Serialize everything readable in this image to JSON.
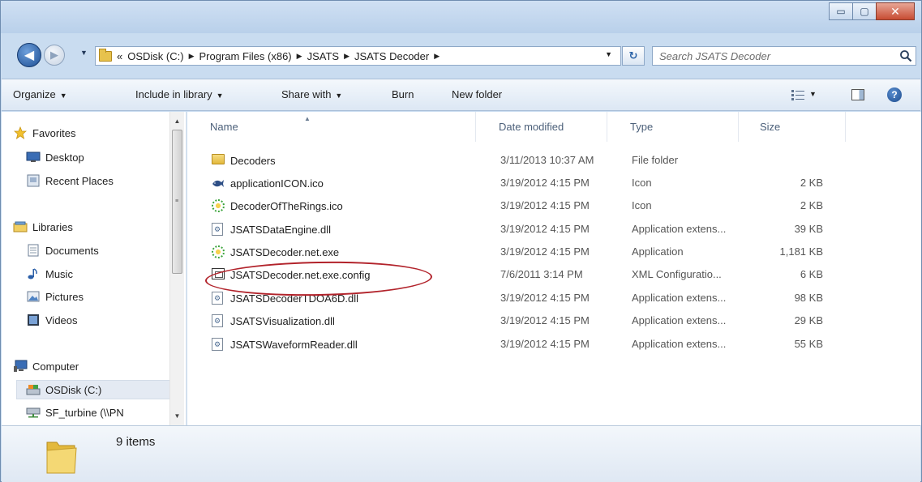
{
  "window": {
    "controls": {
      "minimize": "▭",
      "maximize": "▢",
      "close": "✕"
    }
  },
  "navigation": {
    "back_glyph": "◀",
    "forward_glyph": "▶",
    "history_dropdown": "▼",
    "breadcrumb_overflow": "«",
    "breadcrumbs": [
      "OSDisk (C:)",
      "Program Files (x86)",
      "JSATS",
      "JSATS Decoder"
    ],
    "address_dropdown": "▼",
    "refresh_glyph": "↻",
    "search_placeholder": "Search JSATS Decoder"
  },
  "toolbar": {
    "organize": "Organize",
    "include_in_library": "Include in library",
    "share_with": "Share with",
    "burn": "Burn",
    "new_folder": "New folder",
    "dropdown_glyph": "▼",
    "help_glyph": "?"
  },
  "sidebar": {
    "scroll_up": "▲",
    "scroll_down": "▼",
    "grip": "≡",
    "favorites": {
      "label": "Favorites",
      "icon": "star-icon"
    },
    "favorite_items": [
      {
        "label": "Desktop",
        "icon": "desktop-icon"
      },
      {
        "label": "Recent Places",
        "icon": "recent-places-icon"
      }
    ],
    "libraries": {
      "label": "Libraries",
      "icon": "libraries-icon"
    },
    "library_items": [
      {
        "label": "Documents",
        "icon": "documents-icon"
      },
      {
        "label": "Music",
        "icon": "music-icon"
      },
      {
        "label": "Pictures",
        "icon": "pictures-icon"
      },
      {
        "label": "Videos",
        "icon": "videos-icon"
      }
    ],
    "computer": {
      "label": "Computer",
      "icon": "computer-icon"
    },
    "computer_items": [
      {
        "label": "OSDisk (C:)",
        "icon": "drive-icon",
        "selected": true
      },
      {
        "label": "SF_turbine (\\\\PN",
        "icon": "network-drive-icon"
      }
    ]
  },
  "file_list": {
    "sort_arrow": "▲",
    "columns": [
      "Name",
      "Date modified",
      "Type",
      "Size"
    ],
    "rows": [
      {
        "name": "Decoders",
        "date": "3/11/2013 10:37 AM",
        "type": "File folder",
        "size": "",
        "icon": "folder-icon"
      },
      {
        "name": "applicationICON.ico",
        "date": "3/19/2012 4:15 PM",
        "type": "Icon",
        "size": "2 KB",
        "icon": "fish-icon"
      },
      {
        "name": "DecoderOfTheRings.ico",
        "date": "3/19/2012 4:15 PM",
        "type": "Icon",
        "size": "2 KB",
        "icon": "ring-icon"
      },
      {
        "name": "JSATSDataEngine.dll",
        "date": "3/19/2012 4:15 PM",
        "type": "Application extens...",
        "size": "39 KB",
        "icon": "dll-icon"
      },
      {
        "name": "JSATSDecoder.net.exe",
        "date": "3/19/2012 4:15 PM",
        "type": "Application",
        "size": "1,181 KB",
        "icon": "ring-icon"
      },
      {
        "name": "JSATSDecoder.net.exe.config",
        "date": "7/6/2011 3:14 PM",
        "type": "XML Configuratio...",
        "size": "6 KB",
        "icon": "config-icon"
      },
      {
        "name": "JSATSDecoderTDOA6D.dll",
        "date": "3/19/2012 4:15 PM",
        "type": "Application extens...",
        "size": "98 KB",
        "icon": "dll-icon"
      },
      {
        "name": "JSATSVisualization.dll",
        "date": "3/19/2012 4:15 PM",
        "type": "Application extens...",
        "size": "29 KB",
        "icon": "dll-icon"
      },
      {
        "name": "JSATSWaveformReader.dll",
        "date": "3/19/2012 4:15 PM",
        "type": "Application extens...",
        "size": "55 KB",
        "icon": "dll-icon"
      }
    ]
  },
  "details": {
    "item_count": "9 items"
  },
  "colors": {
    "window_frame": "#c9dcf0",
    "highlight_ellipse": "#b2232b",
    "selected_item": "#e4eaf3"
  }
}
